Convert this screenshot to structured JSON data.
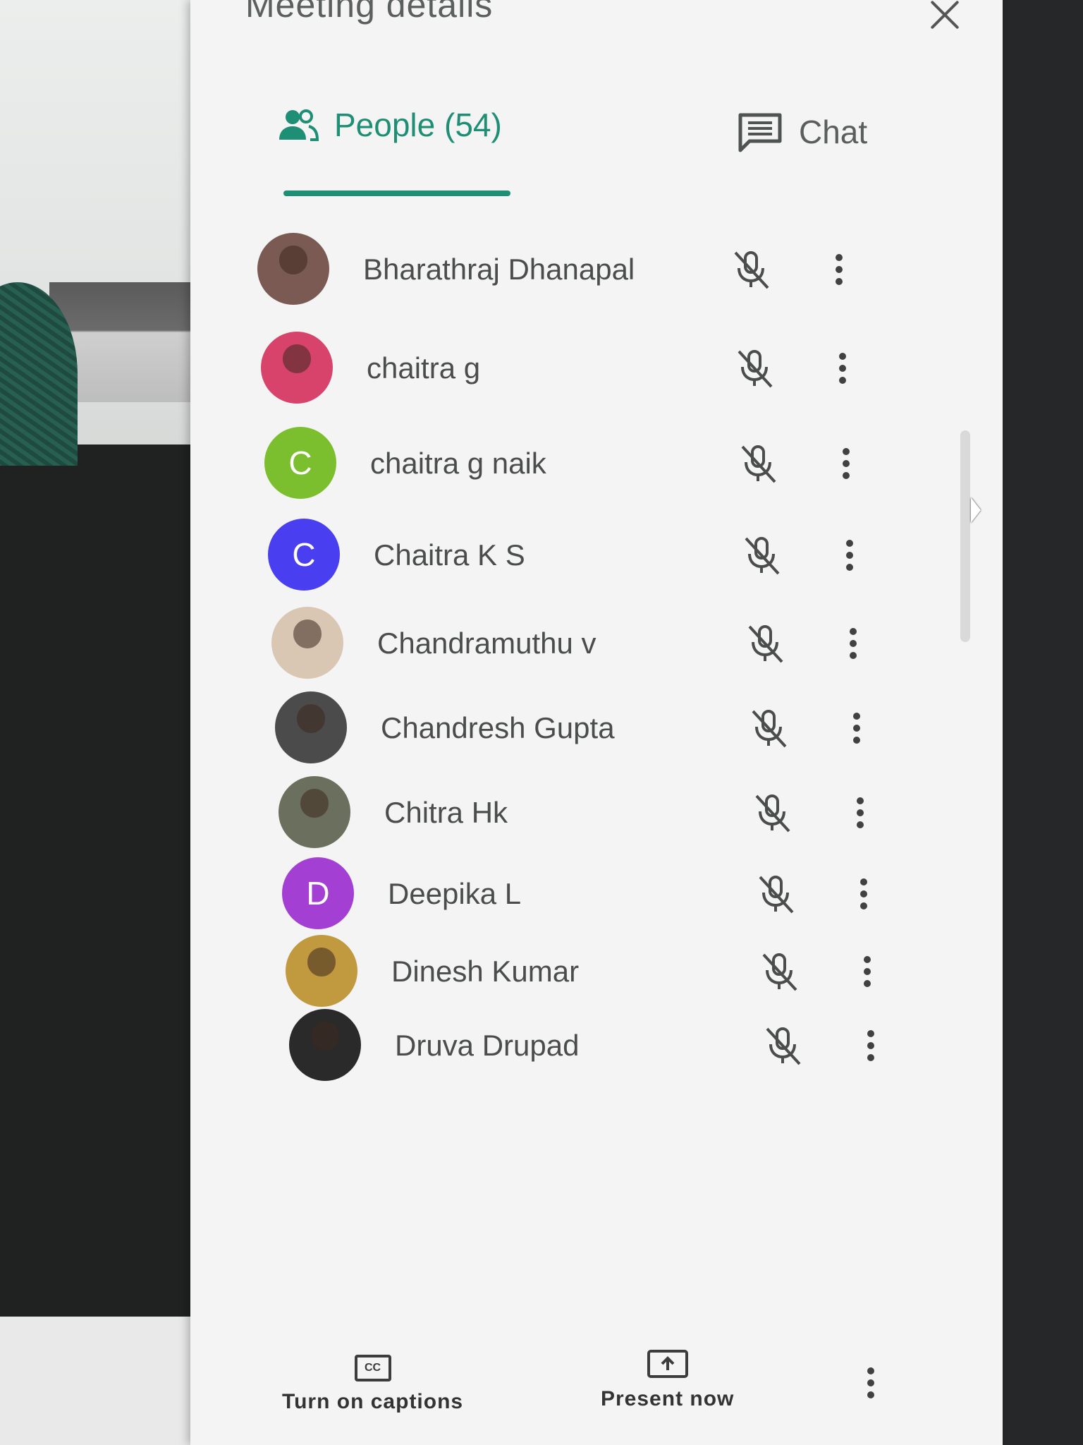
{
  "panel": {
    "title": "Meeting details"
  },
  "tabs": {
    "people": {
      "label": "People (54)",
      "icon": "people-icon",
      "active": true,
      "color": "#1e8e74"
    },
    "chat": {
      "label": "Chat",
      "icon": "chat-icon",
      "active": false
    }
  },
  "participants": [
    {
      "name": "Bharathraj Dhanapal",
      "avatar_type": "photo",
      "avatar_color": "#7a5a52",
      "mic": "muted"
    },
    {
      "name": "chaitra g",
      "avatar_type": "photo",
      "avatar_color": "#d8436b",
      "mic": "muted"
    },
    {
      "name": "chaitra g naik",
      "avatar_type": "initial",
      "initial": "C",
      "avatar_color": "#7cbf2e",
      "mic": "muted"
    },
    {
      "name": "Chaitra K S",
      "avatar_type": "initial",
      "initial": "C",
      "avatar_color": "#4a3ff0",
      "mic": "muted"
    },
    {
      "name": "Chandramuthu v",
      "avatar_type": "photo",
      "avatar_color": "#d9c6b3",
      "mic": "muted"
    },
    {
      "name": "Chandresh Gupta",
      "avatar_type": "photo",
      "avatar_color": "#4b4b4b",
      "mic": "muted"
    },
    {
      "name": "Chitra Hk",
      "avatar_type": "photo",
      "avatar_color": "#6b6f5e",
      "mic": "muted"
    },
    {
      "name": "Deepika L",
      "avatar_type": "initial",
      "initial": "D",
      "avatar_color": "#a43fd4",
      "mic": "muted"
    },
    {
      "name": "Dinesh Kumar",
      "avatar_type": "photo",
      "avatar_color": "#c19a3f",
      "mic": "muted"
    },
    {
      "name": "Druva Drupad",
      "avatar_type": "photo",
      "avatar_color": "#2a2a2a",
      "mic": "muted"
    }
  ],
  "bottom_bar": {
    "captions_label": "Turn on captions",
    "captions_icon": "closed-captions-icon",
    "captions_icon_text": "CC",
    "present_label": "Present now",
    "present_icon": "present-screen-icon"
  }
}
